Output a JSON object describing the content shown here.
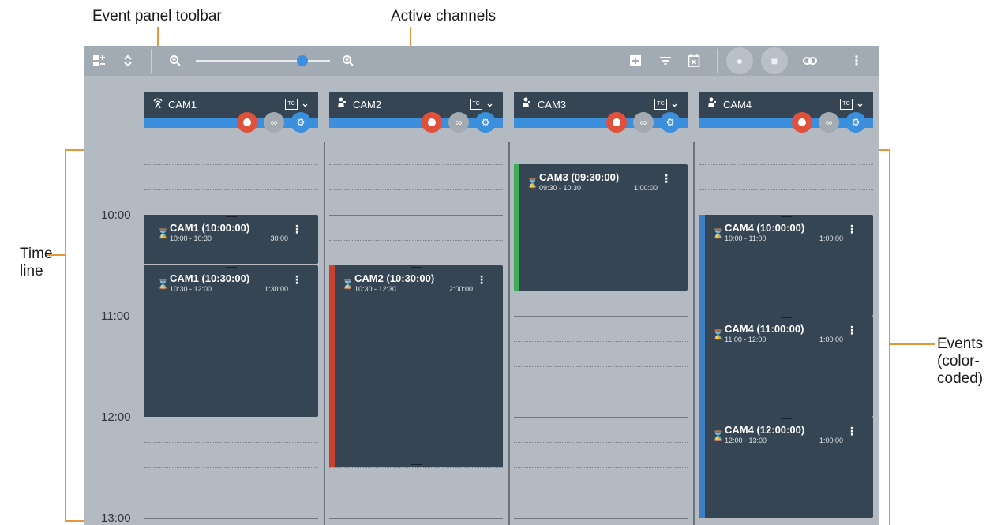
{
  "callouts": {
    "toolbar": "Event panel toolbar",
    "channels": "Active channels",
    "timeline_1": "Time",
    "timeline_2": "line",
    "events_1": "Events",
    "events_2": "(color-",
    "events_3": "coded)"
  },
  "toolbar": {
    "icons": [
      "channel-config-icon",
      "expand-collapse-icon",
      "zoom-out-icon",
      "zoom-in-icon",
      "add-event-icon",
      "filter-icon",
      "clear-schedule-icon",
      "record-group-icon",
      "playout-group-icon",
      "link-icon",
      "more-vertical-icon"
    ],
    "zoom_level": 0.78
  },
  "channels": [
    {
      "name": "CAM1",
      "icon": "antenna-icon",
      "tc": "TC"
    },
    {
      "name": "CAM2",
      "icon": "camera-operator-icon",
      "tc": "TC"
    },
    {
      "name": "CAM3",
      "icon": "camera-operator-icon",
      "tc": "TC"
    },
    {
      "name": "CAM4",
      "icon": "camera-operator-icon",
      "tc": "TC"
    }
  ],
  "timeline": {
    "labels": [
      "10:00",
      "11:00",
      "12:00",
      "13:00"
    ]
  },
  "events": [
    {
      "channel": "CAM1",
      "title": "CAM1 (10:00:00)",
      "range": "10:00 - 10:30",
      "duration": "30:00",
      "color": "#364553"
    },
    {
      "channel": "CAM1",
      "title": "CAM1 (10:30:00)",
      "range": "10:30 - 12:00",
      "duration": "1:30:00",
      "color": "#364553"
    },
    {
      "channel": "CAM2",
      "title": "CAM2 (10:30:00)",
      "range": "10:30 - 12:30",
      "duration": "2:00:00",
      "color": "#c8402e"
    },
    {
      "channel": "CAM3",
      "title": "CAM3 (09:30:00)",
      "range": "09:30 - 10:30",
      "duration": "1:00:00",
      "color": "#3fae5a"
    },
    {
      "channel": "CAM4",
      "title": "CAM4 (10:00:00)",
      "range": "10:00 - 11:00",
      "duration": "1:00:00",
      "color": "#3b7fc4"
    },
    {
      "channel": "CAM4",
      "title": "CAM4 (11:00:00)",
      "range": "11:00 - 12:00",
      "duration": "1:00:00",
      "color": "#3b7fc4"
    },
    {
      "channel": "CAM4",
      "title": "CAM4 (12:00:00)",
      "range": "12:00 - 13:00",
      "duration": "1:00:00",
      "color": "#3b7fc4"
    }
  ]
}
